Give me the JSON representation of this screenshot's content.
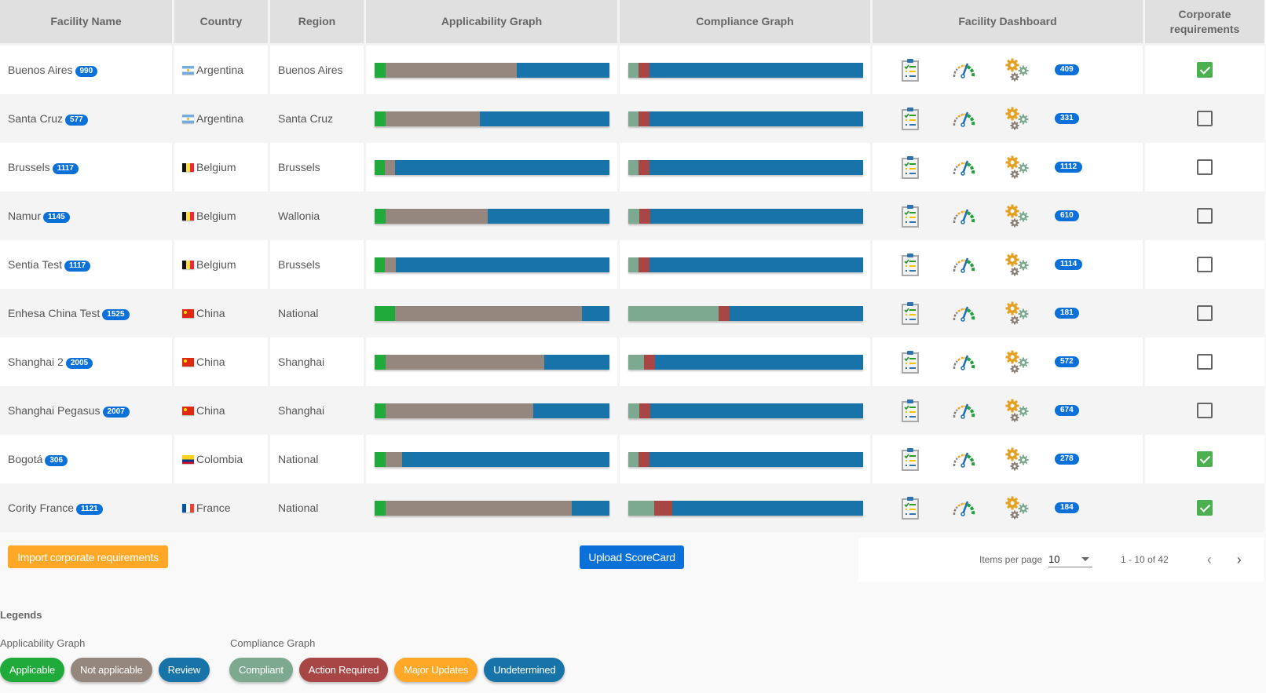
{
  "colors": {
    "applicable": "#1faa3a",
    "not_applicable": "#95877e",
    "review": "#1874a8",
    "compliant": "#7ea991",
    "action_required": "#a84545",
    "major_updates": "#ffa726",
    "undetermined": "#1874a8",
    "badge": "#0b71d9",
    "checkbox_on": "#4caf50"
  },
  "table": {
    "columns": [
      "Facility Name",
      "Country",
      "Region",
      "Applicability Graph",
      "Compliance Graph",
      "Facility Dashboard",
      "Corporate requirements"
    ],
    "rows": [
      {
        "name": "Buenos Aires",
        "id": "990",
        "flag": "ar",
        "country": "Argentina",
        "region": "Buenos Aires",
        "applicability": {
          "applicable": 4.7,
          "not_applicable": 55.9,
          "review": 39.4
        },
        "compliance": {
          "compliant": 4.3,
          "action_required": 4.7,
          "major_updates": 0,
          "undetermined": 91.0
        },
        "dashboard_count": "409",
        "corporate": true
      },
      {
        "name": "Santa Cruz",
        "id": "577",
        "flag": "ar",
        "country": "Argentina",
        "region": "Santa Cruz",
        "applicability": {
          "applicable": 4.7,
          "not_applicable": 40.1,
          "review": 55.2
        },
        "compliance": {
          "compliant": 4.3,
          "action_required": 4.7,
          "major_updates": 0,
          "undetermined": 91.0
        },
        "dashboard_count": "331",
        "corporate": false
      },
      {
        "name": "Brussels",
        "id": "1117",
        "flag": "be",
        "country": "Belgium",
        "region": "Brussels",
        "applicability": {
          "applicable": 4.3,
          "not_applicable": 4.3,
          "review": 91.4
        },
        "compliance": {
          "compliant": 4.3,
          "action_required": 4.7,
          "major_updates": 0,
          "undetermined": 91.0
        },
        "dashboard_count": "1112",
        "corporate": false
      },
      {
        "name": "Namur",
        "id": "1145",
        "flag": "be",
        "country": "Belgium",
        "region": "Wallonia",
        "applicability": {
          "applicable": 4.7,
          "not_applicable": 43.5,
          "review": 51.8
        },
        "compliance": {
          "compliant": 4.7,
          "action_required": 4.7,
          "major_updates": 0,
          "undetermined": 90.6
        },
        "dashboard_count": "610",
        "corporate": false
      },
      {
        "name": "Sentia Test",
        "id": "1117",
        "flag": "be",
        "country": "Belgium",
        "region": "Brussels",
        "applicability": {
          "applicable": 4.3,
          "not_applicable": 4.7,
          "review": 91.0
        },
        "compliance": {
          "compliant": 4.3,
          "action_required": 4.7,
          "major_updates": 0,
          "undetermined": 91.0
        },
        "dashboard_count": "1114",
        "corporate": false
      },
      {
        "name": "Enhesa China Test",
        "id": "1525",
        "flag": "cn",
        "country": "China",
        "region": "National",
        "applicability": {
          "applicable": 8.7,
          "not_applicable": 79.6,
          "review": 11.7
        },
        "compliance": {
          "compliant": 38.5,
          "action_required": 4.7,
          "major_updates": 0,
          "undetermined": 56.8
        },
        "dashboard_count": "181",
        "corporate": false
      },
      {
        "name": "Shanghai 2",
        "id": "2005",
        "flag": "cn",
        "country": "China",
        "region": "Shanghai",
        "applicability": {
          "applicable": 4.7,
          "not_applicable": 67.6,
          "review": 27.7
        },
        "compliance": {
          "compliant": 6.7,
          "action_required": 4.7,
          "major_updates": 0,
          "undetermined": 88.6
        },
        "dashboard_count": "572",
        "corporate": false
      },
      {
        "name": "Shanghai Pegasus",
        "id": "2007",
        "flag": "cn",
        "country": "China",
        "region": "Shanghai",
        "applicability": {
          "applicable": 4.7,
          "not_applicable": 62.9,
          "review": 32.4
        },
        "compliance": {
          "compliant": 4.7,
          "action_required": 4.7,
          "major_updates": 0,
          "undetermined": 90.6
        },
        "dashboard_count": "674",
        "corporate": false
      },
      {
        "name": "Bogotá",
        "id": "306",
        "flag": "co",
        "country": "Colombia",
        "region": "National",
        "applicability": {
          "applicable": 4.7,
          "not_applicable": 7.0,
          "review": 88.3
        },
        "compliance": {
          "compliant": 4.3,
          "action_required": 4.7,
          "major_updates": 0,
          "undetermined": 91.0
        },
        "dashboard_count": "278",
        "corporate": true
      },
      {
        "name": "Cority France",
        "id": "1121",
        "flag": "fr",
        "country": "France",
        "region": "National",
        "applicability": {
          "applicable": 4.7,
          "not_applicable": 79.3,
          "review": 16.0
        },
        "compliance": {
          "compliant": 11.0,
          "action_required": 7.7,
          "major_updates": 0,
          "undetermined": 81.3
        },
        "dashboard_count": "184",
        "corporate": true
      }
    ]
  },
  "footer": {
    "import_label": "Import corporate requirements",
    "upload_label": "Upload ScoreCard"
  },
  "pagination": {
    "items_per_page_label": "Items per page",
    "items_per_page_value": "10",
    "range_label": "1 - 10 of 42",
    "prev_icon": "chevron-left-icon",
    "next_icon": "chevron-right-icon"
  },
  "legends": {
    "title": "Legends",
    "applicability": {
      "title": "Applicability Graph",
      "items": [
        {
          "label": "Applicable",
          "color": "#1faa3a"
        },
        {
          "label": "Not applicable",
          "color": "#95877e"
        },
        {
          "label": "Review",
          "color": "#1874a8"
        }
      ]
    },
    "compliance": {
      "title": "Compliance Graph",
      "items": [
        {
          "label": "Compliant",
          "color": "#7ea991"
        },
        {
          "label": "Action Required",
          "color": "#a84545"
        },
        {
          "label": "Major Updates",
          "color": "#ffa726"
        },
        {
          "label": "Undetermined",
          "color": "#1874a8"
        }
      ]
    }
  }
}
